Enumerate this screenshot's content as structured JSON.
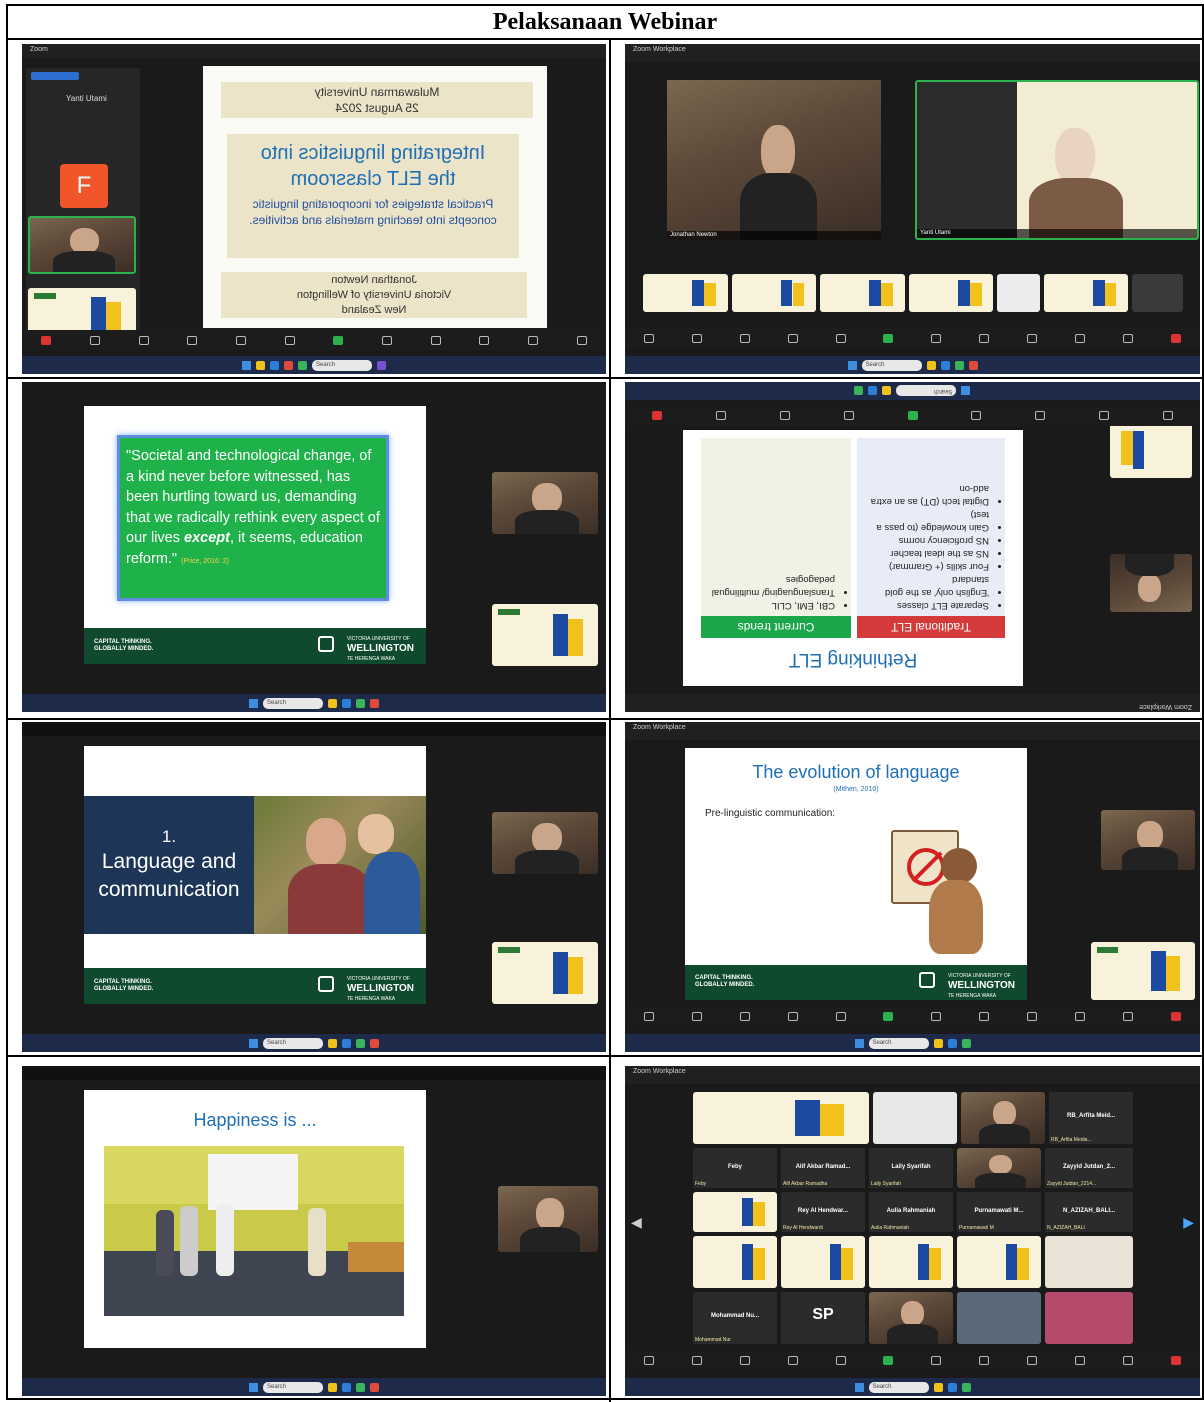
{
  "page_title": "Pelaksanaan Webinar",
  "zoom_app": {
    "name": "Zoom",
    "workplace_label": "Zoom Workplace",
    "search_placeholder": "Search"
  },
  "slide_title": {
    "university_header": "Mulawarman University",
    "date": "25 August 2024",
    "title_line1": "Integrating linguistics into",
    "title_line2": "the ELT classroom",
    "subtitle": "Practical strategies for incorporating linguistic concepts into teaching materials and activities.",
    "presenter": "Jonathan Newton",
    "presenter_affiliation": "Victoria University of Wellington",
    "presenter_country": "New Zealand"
  },
  "panel1_sidebar": {
    "speaker_initial": "F"
  },
  "slide_quote": {
    "text_before": "\"Societal and technological change, of a kind never before witnessed, has been hurtling toward us, demanding that we radically rethink every aspect of our lives ",
    "emphasis": "except",
    "text_after": ", it seems, education reform.\"",
    "citation": "(Price, 2016: 2)"
  },
  "footer_brand": {
    "left_line1": "CAPITAL THINKING.",
    "left_line2": "GLOBALLY MINDED.",
    "wellington_small": "VICTORIA UNIVERSITY OF",
    "wellington": "WELLINGTON",
    "maori": "TE HERENGA WAKA"
  },
  "slide_rethinking": {
    "title": "Rethinking ELT",
    "col_left_header": "Traditional ELT",
    "col_right_header": "Current trends",
    "left_items": [
      "Separate ELT classes",
      "'English only' as the gold standard",
      "Four skills (+ Grammar)",
      "NS as the ideal teacher",
      "NS proficiency norms",
      "Gain knowledge (to pass a test)",
      "Digital tech (DT) as an extra add-on"
    ],
    "right_items": [
      "CBI, EMI, CLIL",
      "Translanguaging/ multilingual pedagogies"
    ]
  },
  "slide_language": {
    "number": "1.",
    "line1": "Language and",
    "line2": "communication"
  },
  "slide_evolution": {
    "title": "The evolution of language",
    "citation": "(Mithen, 2010)",
    "subtitle": "Pre-linguistic communication:"
  },
  "slide_happiness": {
    "title": "Happiness is ..."
  },
  "participants": {
    "speaker_name": "Jonathan Newton",
    "host_name": "Yanti Utami",
    "gallery": [
      {
        "name": "Feby",
        "sub": "Feby"
      },
      {
        "name": "Alif Akbar Ramad...",
        "sub": "Alif Akbar Ramadha"
      },
      {
        "name": "Laily Syarifah",
        "sub": "Laily Syarifah"
      },
      {
        "name": "Zayyid Jutdan_2...",
        "sub": "Zayyid Jutdan_2214..."
      },
      {
        "name": "Rey Al Hendwar...",
        "sub": "Rey Al Hendwardi"
      },
      {
        "name": "Aulia Rahmaniah",
        "sub": "Aulia Rahmaniah"
      },
      {
        "name": "Purnamawati M...",
        "sub": "Purnamawati M"
      },
      {
        "name": "N_AZIZAH_BALI...",
        "sub": "N_AZIZAH_BALI"
      },
      {
        "name": "RB_Arfita Meid...",
        "sub": "RB_Arfita Meida..."
      },
      {
        "name": "Mohammad Nu...",
        "sub": "Mohammad Nur"
      },
      {
        "name": "SP",
        "sub": "SP"
      }
    ]
  },
  "controls": {
    "audio": "Audio",
    "video": "Video",
    "participants": "Participants",
    "chat": "Chat",
    "react": "React",
    "share": "Share",
    "host_tools": "Host tools",
    "ai_companion": "AI Companion",
    "apps": "Apps",
    "transcript": "Transcript/recording",
    "more": "More",
    "end": "End"
  },
  "colors": {
    "slide_blue": "#1f6fb5",
    "slide_green": "#1fb24a",
    "wellington_green": "#0f4a2f",
    "trad_red": "#d43a3a",
    "trend_green": "#1ba64a",
    "navy": "#1d3557"
  }
}
